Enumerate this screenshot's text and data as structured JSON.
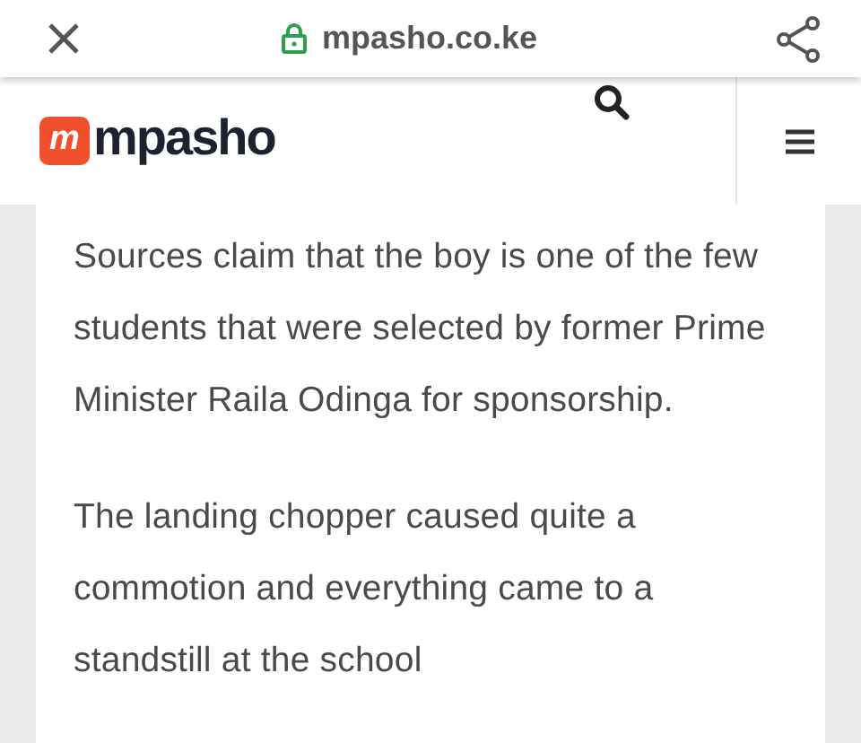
{
  "browser_bar": {
    "url": "mpasho.co.ke"
  },
  "site_header": {
    "logo_mark": "m",
    "logo_text": "mpasho"
  },
  "article": {
    "paragraphs": [
      "Sources claim that the boy is one of the few students that were selected by former Prime Minister Raila Odinga for sponsorship.",
      "The landing chopper caused quite a commotion and everything came to a standstill at the school"
    ]
  }
}
